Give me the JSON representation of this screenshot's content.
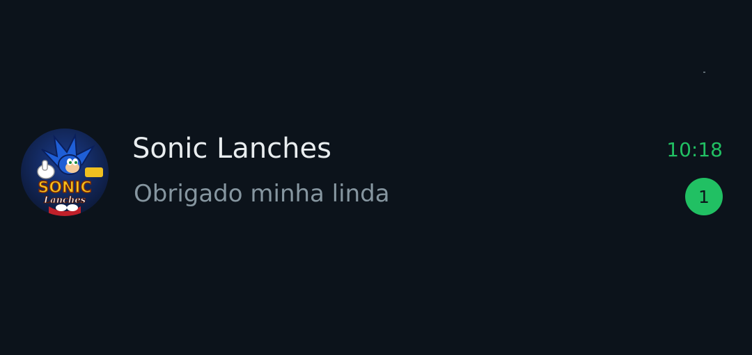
{
  "chat": {
    "name": "Sonic Lanches",
    "preview": "Obrigado minha linda",
    "time": "10:18",
    "unread_count": "1",
    "avatar": {
      "logo_word_1": "SONIC",
      "logo_word_2": "Lanches"
    }
  },
  "colors": {
    "background": "#0c131b",
    "accent_green": "#21c063",
    "name_text": "#e9edef",
    "preview_text": "#8696a0"
  }
}
